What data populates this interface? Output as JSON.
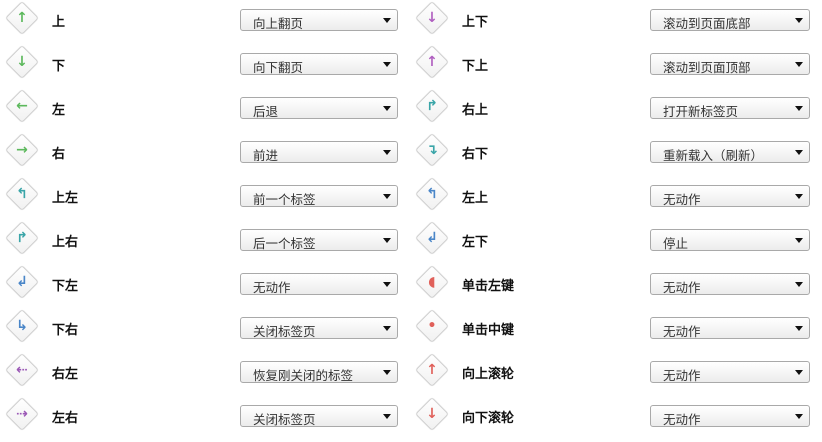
{
  "left": [
    {
      "label": "上",
      "action": "向上翻页",
      "icon": "arrow-up-icon",
      "color": "#5cb85c",
      "glyph": "↑"
    },
    {
      "label": "下",
      "action": "向下翻页",
      "icon": "arrow-down-icon",
      "color": "#5cb85c",
      "glyph": "↓"
    },
    {
      "label": "左",
      "action": "后退",
      "icon": "arrow-left-icon",
      "color": "#5cb85c",
      "glyph": "←"
    },
    {
      "label": "右",
      "action": "前进",
      "icon": "arrow-right-icon",
      "color": "#5cb85c",
      "glyph": "→"
    },
    {
      "label": "上左",
      "action": "前一个标签",
      "icon": "arrow-up-left-icon",
      "color": "#3aa5a8",
      "glyph": "↰"
    },
    {
      "label": "上右",
      "action": "后一个标签",
      "icon": "arrow-up-right-icon",
      "color": "#3aa5a8",
      "glyph": "↱"
    },
    {
      "label": "下左",
      "action": "无动作",
      "icon": "arrow-down-left-icon",
      "color": "#4a86c8",
      "glyph": "↲"
    },
    {
      "label": "下右",
      "action": "关闭标签页",
      "icon": "arrow-down-right-icon",
      "color": "#4a86c8",
      "glyph": "↳"
    },
    {
      "label": "右左",
      "action": "恢复刚关闭的标签",
      "icon": "arrow-right-left-icon",
      "color": "#9b59b6",
      "glyph": "⇠"
    },
    {
      "label": "左右",
      "action": "关闭标签页",
      "icon": "arrow-left-right-icon",
      "color": "#9b59b6",
      "glyph": "⇢"
    }
  ],
  "right": [
    {
      "label": "上下",
      "action": "滚动到页面底部",
      "icon": "arrow-up-down-icon",
      "color": "#b05fc0",
      "glyph": "↓"
    },
    {
      "label": "下上",
      "action": "滚动到页面顶部",
      "icon": "arrow-down-up-icon",
      "color": "#b05fc0",
      "glyph": "↑"
    },
    {
      "label": "右上",
      "action": "打开新标签页",
      "icon": "arrow-right-up-icon",
      "color": "#3aa5a8",
      "glyph": "↱"
    },
    {
      "label": "右下",
      "action": "重新载入（刷新）",
      "icon": "arrow-right-down-icon",
      "color": "#3aa5a8",
      "glyph": "↴"
    },
    {
      "label": "左上",
      "action": "无动作",
      "icon": "arrow-left-up-icon",
      "color": "#4a86c8",
      "glyph": "↰"
    },
    {
      "label": "左下",
      "action": "停止",
      "icon": "arrow-left-down-icon",
      "color": "#4a86c8",
      "glyph": "↲"
    },
    {
      "label": "单击左键",
      "action": "无动作",
      "icon": "left-click-icon",
      "color": "#e0605a",
      "glyph": "◖"
    },
    {
      "label": "单击中键",
      "action": "无动作",
      "icon": "middle-click-icon",
      "color": "#e0605a",
      "glyph": "•"
    },
    {
      "label": "向上滚轮",
      "action": "无动作",
      "icon": "wheel-up-icon",
      "color": "#e0605a",
      "glyph": "↑"
    },
    {
      "label": "向下滚轮",
      "action": "无动作",
      "icon": "wheel-down-icon",
      "color": "#e0605a",
      "glyph": "↓"
    }
  ]
}
